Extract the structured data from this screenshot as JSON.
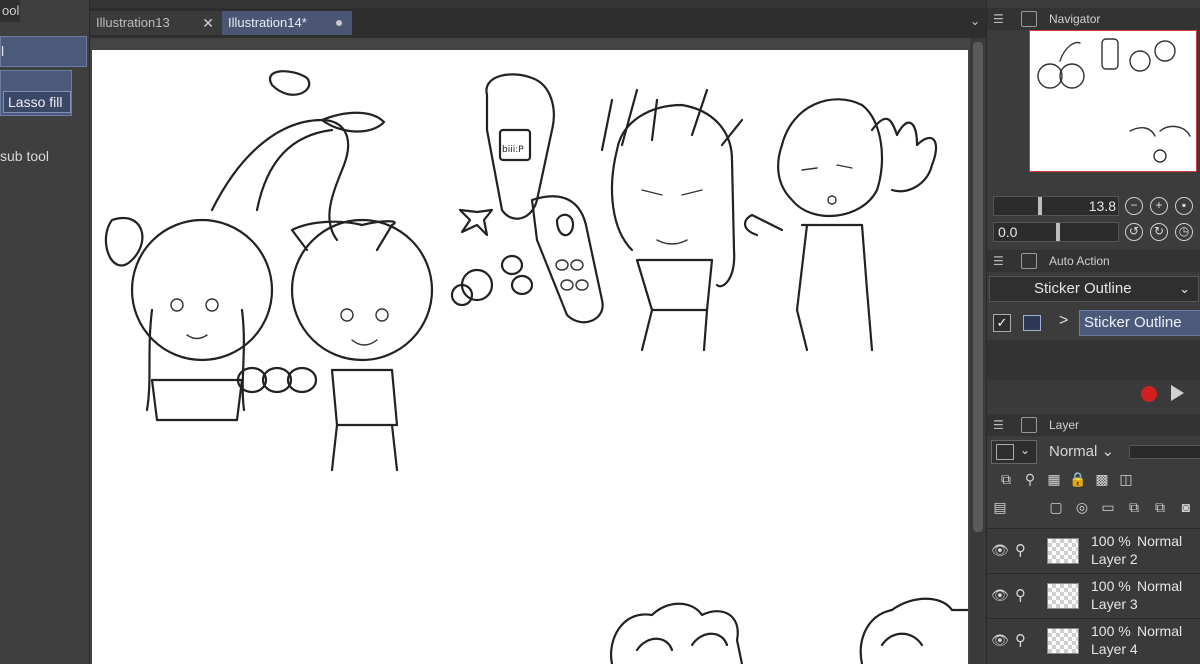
{
  "left_panel": {
    "tool_tab_label": "ool",
    "subtool_top_label": "l",
    "lasso_fill_label": "Lasso fill",
    "sub_tool_label": "sub tool"
  },
  "tabs": [
    {
      "label": "Illustration13",
      "close": "✕"
    },
    {
      "label": "Illustration14*"
    }
  ],
  "tab_overflow": "⌄",
  "navigator": {
    "title": "Navigator",
    "zoom_value": "13.8",
    "rotation_value": "0.0"
  },
  "auto_action": {
    "title": "Auto Action",
    "set_name": "Sticker Outline",
    "action_name": "Sticker Outline",
    "checkbox": "✓",
    "expand": ">"
  },
  "layer_panel": {
    "title": "Layer",
    "blend_mode": "Normal",
    "layers": [
      {
        "opacity": "100 %",
        "mode": "Normal",
        "name": "Layer 2"
      },
      {
        "opacity": "100 %",
        "mode": "Normal",
        "name": "Layer 3"
      },
      {
        "opacity": "100 %",
        "mode": "Normal",
        "name": "Layer 4"
      }
    ]
  },
  "canvas": {
    "phone_screen_text": "biii:P"
  },
  "colors": {
    "accent": "#4b5a7a",
    "record": "#d21f1f",
    "navigator_frame": "#d43a3a"
  }
}
